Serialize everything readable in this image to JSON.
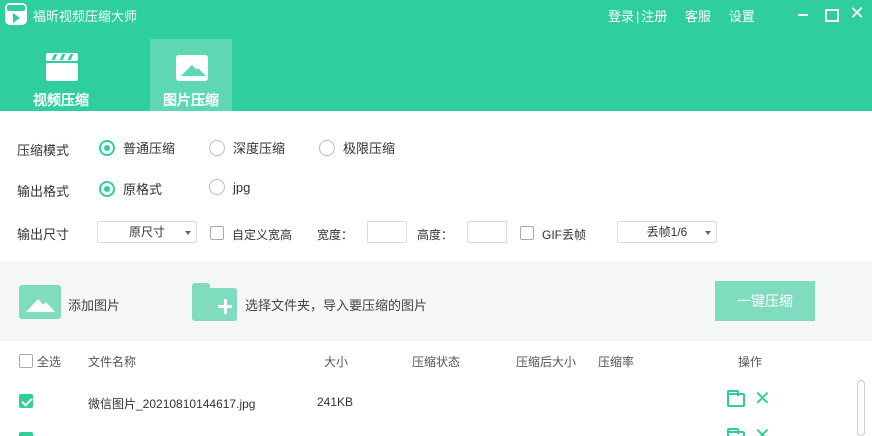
{
  "app": {
    "title": "福昕视频压缩大师"
  },
  "top_links": {
    "login": "登录",
    "separator": "|",
    "register": "注册",
    "service": "客服",
    "settings": "设置"
  },
  "tabs": [
    {
      "label": "视频压缩",
      "icon": "clapperboard-icon",
      "active": false
    },
    {
      "label": "图片压缩",
      "icon": "image-icon",
      "active": true
    }
  ],
  "options": {
    "mode": {
      "label": "压缩模式",
      "choices": [
        "普通压缩",
        "深度压缩",
        "极限压缩"
      ],
      "selected": "普通压缩"
    },
    "format": {
      "label": "输出格式",
      "choices": [
        "原格式",
        "jpg"
      ],
      "selected": "原格式"
    },
    "size": {
      "label": "输出尺寸",
      "size_select": "原尺寸",
      "custom_label": "自定义宽高",
      "custom_checked": false,
      "width_label": "宽度：",
      "width_value": "",
      "height_label": "高度：",
      "height_value": "",
      "gif_label": "GIF丢帧",
      "gif_checked": false,
      "gif_select": "丢帧1/6"
    }
  },
  "toolbar": {
    "add_image": "添加图片",
    "add_folder": "选择文件夹，导入要压缩的图片",
    "compress_all": "一键压缩"
  },
  "table": {
    "select_all": "全选",
    "select_all_checked": false,
    "columns": [
      "文件名称",
      "大小",
      "压缩状态",
      "压缩后大小",
      "压缩率",
      "操作"
    ],
    "rows": [
      {
        "checked": true,
        "name": "微信图片_20210810144617.jpg",
        "size": "241KB",
        "status": "",
        "compressed_size": "",
        "ratio": ""
      }
    ]
  },
  "colors": {
    "accent": "#2fcf9d",
    "accent_light": "#7fdcbe",
    "tab_active": "#5ed8b3"
  }
}
